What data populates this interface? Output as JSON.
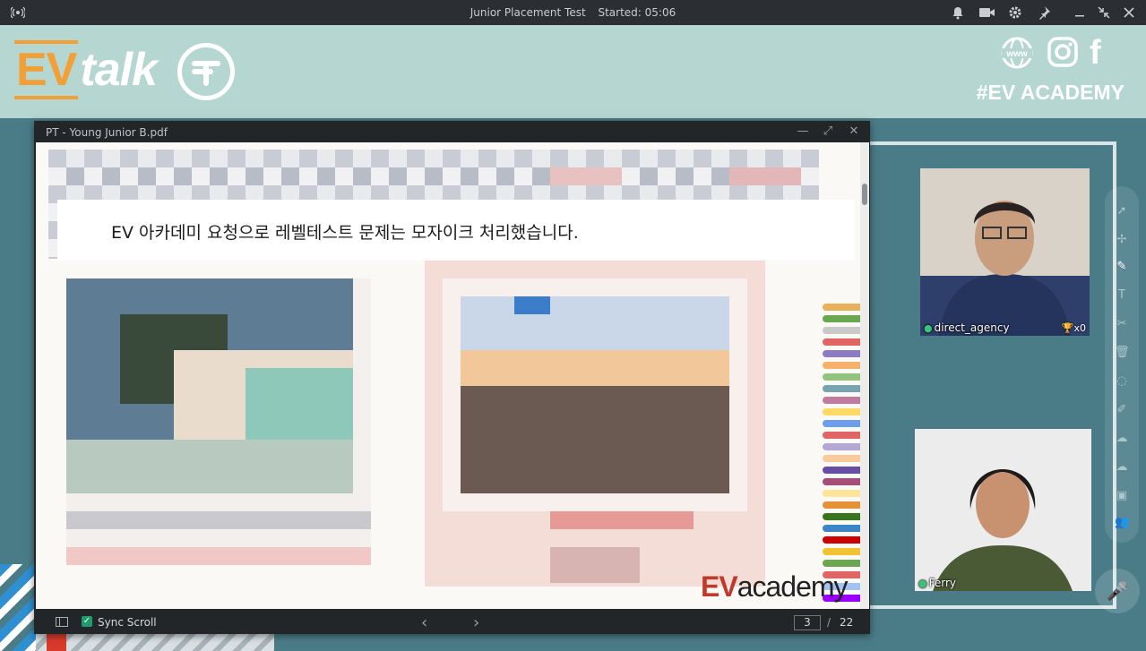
{
  "titlebar": {
    "title": "Junior Placement Test",
    "started": "Started: 05:06",
    "icons": [
      "broadcast-icon",
      "bell-icon",
      "camera-icon",
      "gear-icon",
      "pin-icon",
      "minimize-icon",
      "fullscreen-exit-icon",
      "close-icon"
    ]
  },
  "header": {
    "logo_ev": "EV",
    "logo_talk": "talk",
    "social_icons": [
      "www-icon",
      "instagram-icon",
      "facebook-icon"
    ],
    "www_label": "www",
    "facebook_glyph": "f",
    "hashtag": "#EV ACADEMY"
  },
  "pdf": {
    "filename": "PT - Young Junior B.pdf",
    "notice": "EV 아카데미 요청으로 레벨테스트 문제는 모자이크 처리했습니다.",
    "footer_logo_ev": "EV",
    "footer_logo_rest": "academy",
    "sync_scroll_label": "Sync Scroll",
    "sync_scroll_checked": true,
    "current_page": "3",
    "page_separator": "/",
    "total_pages": "22"
  },
  "videos": [
    {
      "name": "direct_agency",
      "trophy_count": "x0"
    },
    {
      "name": "Ferry"
    }
  ],
  "side_tools": [
    "cursor-icon",
    "laser-icon",
    "pen-icon",
    "text-icon",
    "scissors-icon",
    "trash-icon",
    "shape-icon",
    "edit-icon",
    "cloud-sync-icon",
    "cloud-icon",
    "toolbox-icon",
    "users-icon"
  ],
  "colors": {
    "background": "#4a7c88",
    "header": "#b6d6d2",
    "accent_orange": "#f2a035",
    "titlebar": "#2b2f33",
    "check_green": "#1e9c6d"
  }
}
